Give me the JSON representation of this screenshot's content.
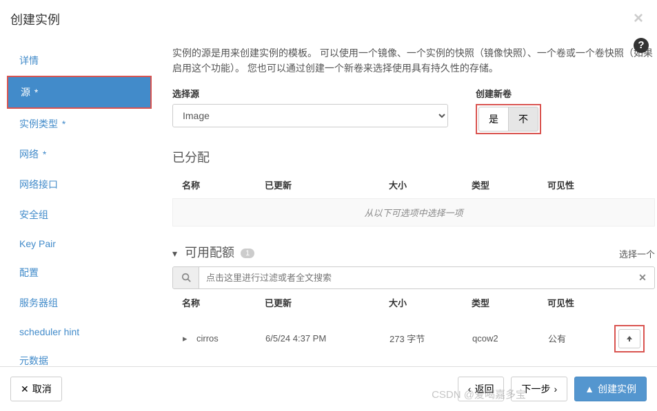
{
  "header": {
    "title": "创建实例",
    "close_glyph": "×"
  },
  "help": {
    "glyph": "?"
  },
  "sidebar": {
    "items": [
      {
        "label": "详情",
        "active": false,
        "required": false
      },
      {
        "label": "源",
        "active": true,
        "required": true
      },
      {
        "label": "实例类型",
        "active": false,
        "required": true
      },
      {
        "label": "网络",
        "active": false,
        "required": true
      },
      {
        "label": "网络接口",
        "active": false,
        "required": false
      },
      {
        "label": "安全组",
        "active": false,
        "required": false
      },
      {
        "label": "Key Pair",
        "active": false,
        "required": false
      },
      {
        "label": "配置",
        "active": false,
        "required": false
      },
      {
        "label": "服务器组",
        "active": false,
        "required": false
      },
      {
        "label": "scheduler hint",
        "active": false,
        "required": false
      },
      {
        "label": "元数据",
        "active": false,
        "required": false
      }
    ]
  },
  "content": {
    "description": "实例的源是用来创建实例的模板。 可以使用一个镜像、一个实例的快照（镜像快照）、一个卷或一个卷快照（如果启用这个功能）。 您也可以通过创建一个新卷来选择使用具有持久性的存储。",
    "source_label": "选择源",
    "source_value": "Image",
    "volume_label": "创建新卷",
    "volume_yes": "是",
    "volume_no": "不"
  },
  "allocated": {
    "title": "已分配",
    "empty_text": "从以下可选项中选择一项"
  },
  "columns": {
    "name": "名称",
    "updated": "已更新",
    "size": "大小",
    "type": "类型",
    "visibility": "可见性"
  },
  "available": {
    "title": "可用配额",
    "count": "1",
    "select_one": "选择一个",
    "search_placeholder": "点击这里进行过滤或者全文搜索",
    "items": [
      {
        "name": "cirros",
        "updated": "6/5/24 4:37 PM",
        "size": "273 字节",
        "type": "qcow2",
        "visibility": "公有"
      }
    ]
  },
  "footer": {
    "cancel": "取消",
    "back": "返回",
    "next": "下一步",
    "create": "创建实例"
  },
  "watermark": "CSDN @爱喝嘉多宝"
}
